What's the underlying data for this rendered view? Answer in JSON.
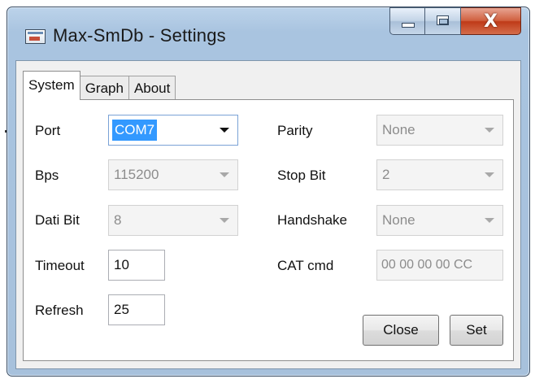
{
  "window": {
    "title": "Max-SmDb - Settings",
    "close_glyph": "X"
  },
  "tabs": [
    {
      "label": "System",
      "active": true
    },
    {
      "label": "Graph",
      "active": false
    },
    {
      "label": "About",
      "active": false
    }
  ],
  "system": {
    "port": {
      "label": "Port",
      "value": "COM7"
    },
    "bps": {
      "label": "Bps",
      "value": "115200"
    },
    "data_bits": {
      "label": "Dati Bit",
      "value": "8"
    },
    "timeout": {
      "label": "Timeout",
      "value": "10"
    },
    "refresh": {
      "label": "Refresh",
      "value": "25"
    },
    "parity": {
      "label": "Parity",
      "value": "None"
    },
    "stop_bit": {
      "label": "Stop Bit",
      "value": "2"
    },
    "handshake": {
      "label": "Handshake",
      "value": "None"
    },
    "cat_cmd": {
      "label": "CAT cmd",
      "value": "00 00 00 00 CC"
    }
  },
  "buttons": {
    "close": "Close",
    "set": "Set"
  },
  "icons": {
    "app": "monitor-app-icon",
    "minimize": "minimize-icon",
    "maximize": "maximize-icon",
    "close": "close-icon",
    "dropdown": "chevron-down-icon"
  }
}
